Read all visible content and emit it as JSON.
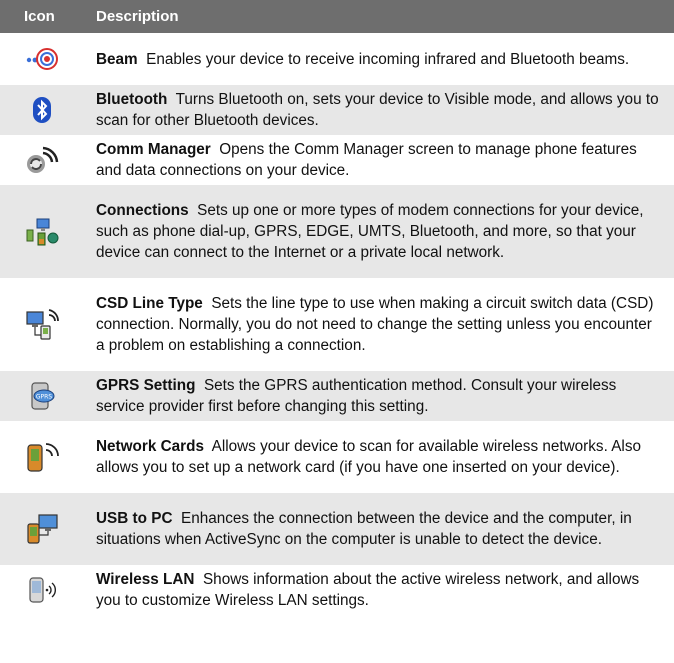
{
  "header": {
    "icon": "Icon",
    "description": "Description"
  },
  "rows": [
    {
      "icon": "beam-icon",
      "title": "Beam",
      "text": "Enables your device to receive incoming infrared and Bluetooth beams."
    },
    {
      "icon": "bluetooth-icon",
      "title": "Bluetooth",
      "text": "Turns Bluetooth on, sets your device to Visible mode, and allows you to scan for other Bluetooth devices."
    },
    {
      "icon": "comm-manager-icon",
      "title": "Comm Manager",
      "text": "Opens the Comm Manager screen to manage phone features and data connections on your device."
    },
    {
      "icon": "connections-icon",
      "title": "Connections",
      "text": "Sets up one or more types of modem connections for your device, such as phone dial-up, GPRS, EDGE, UMTS, Bluetooth, and more, so that your device can connect to the Internet or a private local network."
    },
    {
      "icon": "csd-line-type-icon",
      "title": "CSD Line Type",
      "text": "Sets the line type to use when making a circuit switch data (CSD) connection. Normally, you do not need to change the setting unless you encounter a problem on establishing a connection."
    },
    {
      "icon": "gprs-setting-icon",
      "title": "GPRS Setting",
      "text": "Sets the GPRS authentication method. Consult your wireless service provider first before changing this setting."
    },
    {
      "icon": "network-cards-icon",
      "title": "Network Cards",
      "text": "Allows your device to scan for available wireless networks. Also allows you to set up a network card (if you have one inserted on your device)."
    },
    {
      "icon": "usb-to-pc-icon",
      "title": "USB to PC",
      "text": "Enhances the connection between the device and the computer, in situations when ActiveSync on the computer is unable to detect the device."
    },
    {
      "icon": "wireless-lan-icon",
      "title": "Wireless LAN",
      "text": "Shows information about the active wireless network, and allows you to customize Wireless LAN settings."
    }
  ]
}
